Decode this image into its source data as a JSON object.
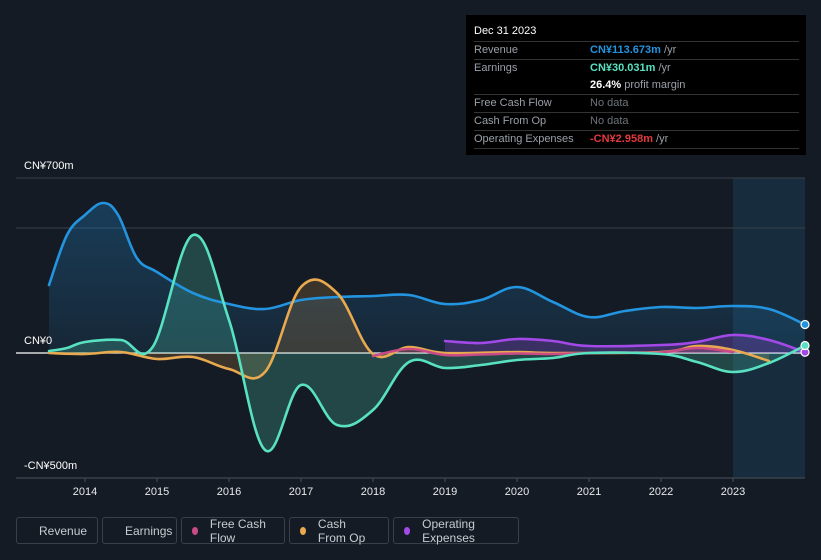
{
  "tooltip": {
    "date": "Dec 31 2023",
    "rows": [
      {
        "label": "Revenue",
        "value": "CN¥113.673m",
        "unit": " /yr",
        "color": "#2394df"
      },
      {
        "label": "Earnings",
        "value": "CN¥30.031m",
        "unit": " /yr",
        "color": "#58e2c2"
      },
      {
        "label": "",
        "value": "26.4%",
        "unit": " profit margin",
        "color": "#ffffff"
      },
      {
        "label": "Free Cash Flow",
        "value": "No data",
        "unit": "",
        "color": "#6f747c"
      },
      {
        "label": "Cash From Op",
        "value": "No data",
        "unit": "",
        "color": "#6f747c"
      },
      {
        "label": "Operating Expenses",
        "value": "-CN¥2.958m",
        "unit": " /yr",
        "color": "#e2393e"
      }
    ]
  },
  "legend": [
    {
      "label": "Revenue",
      "color": "#2394df"
    },
    {
      "label": "Earnings",
      "color": "#58e2c2"
    },
    {
      "label": "Free Cash Flow",
      "color": "#c84b88"
    },
    {
      "label": "Cash From Op",
      "color": "#e9a94f"
    },
    {
      "label": "Operating Expenses",
      "color": "#a349e8"
    }
  ],
  "chart_data": {
    "type": "area",
    "title": "",
    "xlabel": "",
    "ylabel": "",
    "currency_unit": "CN¥ millions",
    "x_ticks": [
      "2014",
      "2015",
      "2016",
      "2017",
      "2018",
      "2019",
      "2020",
      "2021",
      "2022",
      "2023"
    ],
    "y_ticks": [
      {
        "value": 700,
        "label": "CN¥700m"
      },
      {
        "value": 0,
        "label": "CN¥0"
      },
      {
        "value": -500,
        "label": "-CN¥500m"
      }
    ],
    "ylim": [
      -500,
      700
    ],
    "xlim": [
      2013.5,
      2024.0
    ],
    "grid": true,
    "highlight_period": [
      2023.0,
      2024.0
    ],
    "legend_position": "bottom",
    "series": [
      {
        "name": "Revenue",
        "color": "#2394df",
        "x": [
          2013.5,
          2013.75,
          2014.0,
          2014.25,
          2014.46,
          2014.72,
          2015.0,
          2015.5,
          2016.0,
          2016.5,
          2017.0,
          2017.5,
          2018.0,
          2018.5,
          2019.0,
          2019.5,
          2020.0,
          2020.5,
          2021.0,
          2021.5,
          2022.0,
          2022.5,
          2023.0,
          2023.5,
          2024.0
        ],
        "values": [
          272,
          472,
          552,
          600,
          552,
          380,
          324,
          240,
          196,
          176,
          212,
          224,
          228,
          232,
          196,
          212,
          264,
          204,
          144,
          168,
          184,
          180,
          188,
          176,
          114
        ]
      },
      {
        "name": "Earnings",
        "color": "#58e2c2",
        "x": [
          2013.5,
          2013.75,
          2014.0,
          2014.5,
          2014.94,
          2015.5,
          2016.0,
          2016.5,
          2017.0,
          2017.5,
          2018.0,
          2018.5,
          2019.0,
          2019.5,
          2020.0,
          2020.5,
          2021.0,
          2022.0,
          2022.5,
          2023.0,
          2023.5,
          2024.0
        ],
        "values": [
          8,
          20,
          44,
          52,
          24,
          472,
          132,
          -388,
          -128,
          -288,
          -228,
          -36,
          -60,
          -48,
          -28,
          -20,
          0,
          -4,
          -36,
          -76,
          -40,
          30
        ]
      },
      {
        "name": "Free Cash Flow",
        "color": "#c84b88",
        "x": [
          2018.0,
          2018.5,
          2019.0,
          2019.5,
          2020.0,
          2020.5,
          2021.0,
          2021.5,
          2022.0,
          2022.5,
          2023.0
        ],
        "values": [
          -12,
          16,
          -8,
          -6,
          -2,
          -4,
          0,
          2,
          2,
          20,
          4
        ]
      },
      {
        "name": "Cash From Op",
        "color": "#e9a94f",
        "x": [
          2013.5,
          2014.0,
          2014.5,
          2015.0,
          2015.5,
          2016.0,
          2016.5,
          2017.0,
          2017.5,
          2018.0,
          2018.5,
          2019.0,
          2020.0,
          2020.5,
          2022.0,
          2022.5,
          2023.0,
          2023.5
        ],
        "values": [
          0,
          -4,
          4,
          -24,
          -16,
          -64,
          -76,
          264,
          240,
          -4,
          24,
          0,
          4,
          0,
          4,
          28,
          12,
          -32
        ]
      },
      {
        "name": "Operating Expenses",
        "color": "#a349e8",
        "x": [
          2019.0,
          2019.5,
          2020.0,
          2020.5,
          2021.0,
          2022.0,
          2022.5,
          2023.0,
          2023.5,
          2024.0
        ],
        "values": [
          48,
          40,
          56,
          48,
          28,
          32,
          44,
          72,
          52,
          3
        ]
      }
    ]
  }
}
